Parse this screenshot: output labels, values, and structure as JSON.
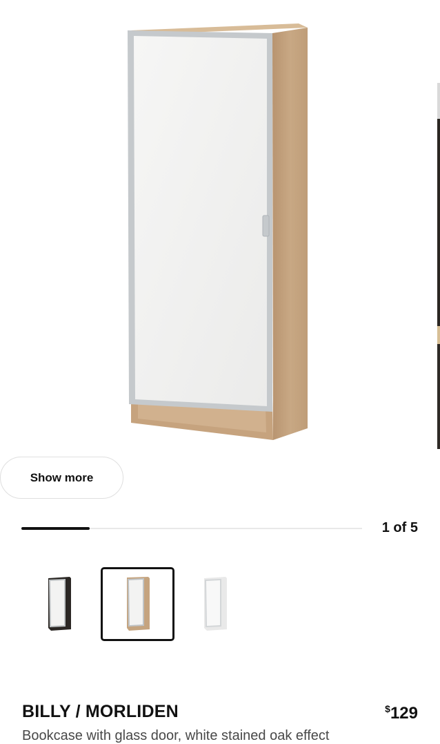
{
  "gallery": {
    "main_image_alt": "BILLY / MORLIDEN bookcase, white stained oak effect with glass door",
    "show_more_label": "Show more",
    "counter_text": "1 of 5",
    "progress": 0.2
  },
  "thumbnails": [
    {
      "variant": "black-brown",
      "selected": false
    },
    {
      "variant": "white-stained-oak",
      "selected": true
    },
    {
      "variant": "white",
      "selected": false
    }
  ],
  "product": {
    "name": "BILLY / MORLIDEN",
    "price_currency": "$",
    "price_amount": "129",
    "description": "Bookcase with glass door, white stained oak effect"
  },
  "colors": {
    "text": "#111111",
    "wood": "#c9a985",
    "door_frame": "#c4c8cb",
    "door_glass": "#f2f2f1"
  }
}
